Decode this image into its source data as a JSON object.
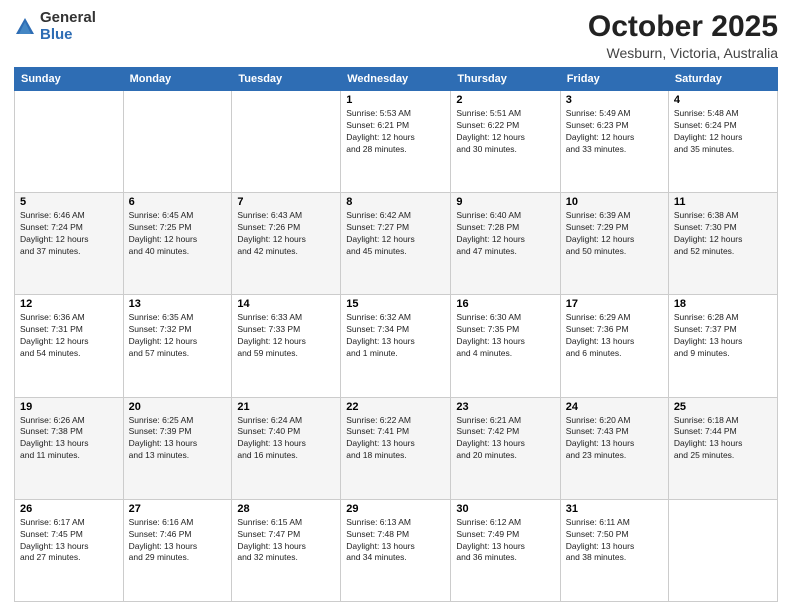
{
  "header": {
    "logo_general": "General",
    "logo_blue": "Blue",
    "month_title": "October 2025",
    "subtitle": "Wesburn, Victoria, Australia"
  },
  "days_of_week": [
    "Sunday",
    "Monday",
    "Tuesday",
    "Wednesday",
    "Thursday",
    "Friday",
    "Saturday"
  ],
  "weeks": [
    [
      {
        "day": "",
        "info": ""
      },
      {
        "day": "",
        "info": ""
      },
      {
        "day": "",
        "info": ""
      },
      {
        "day": "1",
        "info": "Sunrise: 5:53 AM\nSunset: 6:21 PM\nDaylight: 12 hours\nand 28 minutes."
      },
      {
        "day": "2",
        "info": "Sunrise: 5:51 AM\nSunset: 6:22 PM\nDaylight: 12 hours\nand 30 minutes."
      },
      {
        "day": "3",
        "info": "Sunrise: 5:49 AM\nSunset: 6:23 PM\nDaylight: 12 hours\nand 33 minutes."
      },
      {
        "day": "4",
        "info": "Sunrise: 5:48 AM\nSunset: 6:24 PM\nDaylight: 12 hours\nand 35 minutes."
      }
    ],
    [
      {
        "day": "5",
        "info": "Sunrise: 6:46 AM\nSunset: 7:24 PM\nDaylight: 12 hours\nand 37 minutes."
      },
      {
        "day": "6",
        "info": "Sunrise: 6:45 AM\nSunset: 7:25 PM\nDaylight: 12 hours\nand 40 minutes."
      },
      {
        "day": "7",
        "info": "Sunrise: 6:43 AM\nSunset: 7:26 PM\nDaylight: 12 hours\nand 42 minutes."
      },
      {
        "day": "8",
        "info": "Sunrise: 6:42 AM\nSunset: 7:27 PM\nDaylight: 12 hours\nand 45 minutes."
      },
      {
        "day": "9",
        "info": "Sunrise: 6:40 AM\nSunset: 7:28 PM\nDaylight: 12 hours\nand 47 minutes."
      },
      {
        "day": "10",
        "info": "Sunrise: 6:39 AM\nSunset: 7:29 PM\nDaylight: 12 hours\nand 50 minutes."
      },
      {
        "day": "11",
        "info": "Sunrise: 6:38 AM\nSunset: 7:30 PM\nDaylight: 12 hours\nand 52 minutes."
      }
    ],
    [
      {
        "day": "12",
        "info": "Sunrise: 6:36 AM\nSunset: 7:31 PM\nDaylight: 12 hours\nand 54 minutes."
      },
      {
        "day": "13",
        "info": "Sunrise: 6:35 AM\nSunset: 7:32 PM\nDaylight: 12 hours\nand 57 minutes."
      },
      {
        "day": "14",
        "info": "Sunrise: 6:33 AM\nSunset: 7:33 PM\nDaylight: 12 hours\nand 59 minutes."
      },
      {
        "day": "15",
        "info": "Sunrise: 6:32 AM\nSunset: 7:34 PM\nDaylight: 13 hours\nand 1 minute."
      },
      {
        "day": "16",
        "info": "Sunrise: 6:30 AM\nSunset: 7:35 PM\nDaylight: 13 hours\nand 4 minutes."
      },
      {
        "day": "17",
        "info": "Sunrise: 6:29 AM\nSunset: 7:36 PM\nDaylight: 13 hours\nand 6 minutes."
      },
      {
        "day": "18",
        "info": "Sunrise: 6:28 AM\nSunset: 7:37 PM\nDaylight: 13 hours\nand 9 minutes."
      }
    ],
    [
      {
        "day": "19",
        "info": "Sunrise: 6:26 AM\nSunset: 7:38 PM\nDaylight: 13 hours\nand 11 minutes."
      },
      {
        "day": "20",
        "info": "Sunrise: 6:25 AM\nSunset: 7:39 PM\nDaylight: 13 hours\nand 13 minutes."
      },
      {
        "day": "21",
        "info": "Sunrise: 6:24 AM\nSunset: 7:40 PM\nDaylight: 13 hours\nand 16 minutes."
      },
      {
        "day": "22",
        "info": "Sunrise: 6:22 AM\nSunset: 7:41 PM\nDaylight: 13 hours\nand 18 minutes."
      },
      {
        "day": "23",
        "info": "Sunrise: 6:21 AM\nSunset: 7:42 PM\nDaylight: 13 hours\nand 20 minutes."
      },
      {
        "day": "24",
        "info": "Sunrise: 6:20 AM\nSunset: 7:43 PM\nDaylight: 13 hours\nand 23 minutes."
      },
      {
        "day": "25",
        "info": "Sunrise: 6:18 AM\nSunset: 7:44 PM\nDaylight: 13 hours\nand 25 minutes."
      }
    ],
    [
      {
        "day": "26",
        "info": "Sunrise: 6:17 AM\nSunset: 7:45 PM\nDaylight: 13 hours\nand 27 minutes."
      },
      {
        "day": "27",
        "info": "Sunrise: 6:16 AM\nSunset: 7:46 PM\nDaylight: 13 hours\nand 29 minutes."
      },
      {
        "day": "28",
        "info": "Sunrise: 6:15 AM\nSunset: 7:47 PM\nDaylight: 13 hours\nand 32 minutes."
      },
      {
        "day": "29",
        "info": "Sunrise: 6:13 AM\nSunset: 7:48 PM\nDaylight: 13 hours\nand 34 minutes."
      },
      {
        "day": "30",
        "info": "Sunrise: 6:12 AM\nSunset: 7:49 PM\nDaylight: 13 hours\nand 36 minutes."
      },
      {
        "day": "31",
        "info": "Sunrise: 6:11 AM\nSunset: 7:50 PM\nDaylight: 13 hours\nand 38 minutes."
      },
      {
        "day": "",
        "info": ""
      }
    ]
  ]
}
